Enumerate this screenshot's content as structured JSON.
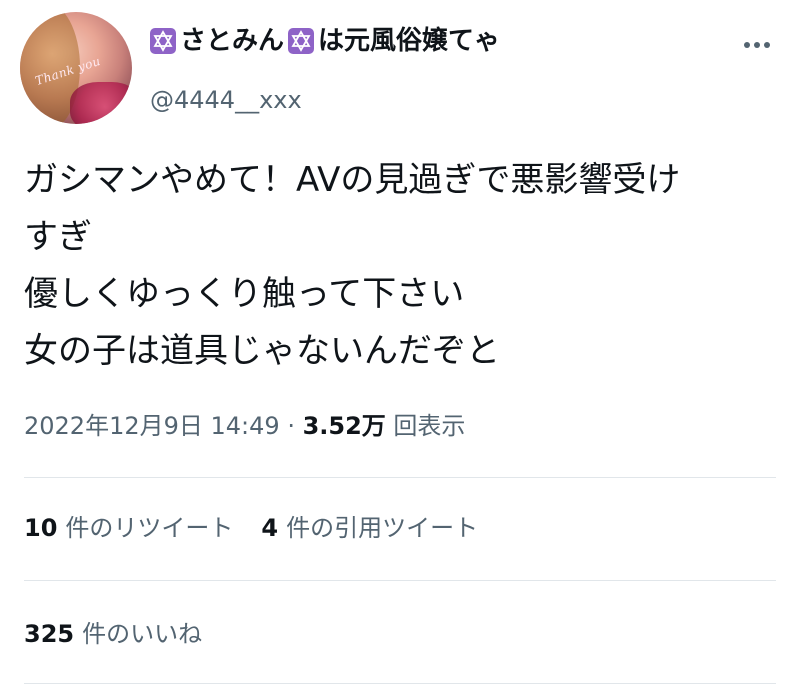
{
  "author": {
    "display_name_prefix_icon": "star-of-david-icon",
    "display_name_part1": "さとみん",
    "display_name_mid_icon": "star-of-david-icon",
    "display_name_part2": "は元風俗嬢てゃ",
    "handle": "@4444__xxx",
    "avatar_script": "Thank you"
  },
  "tweet": {
    "text": "ガシマンやめて！AVの見過ぎで悪影響受け\nすぎ\n優しくゆっくり触って下さい\n女の子は道具じゃないんだぞと",
    "timestamp": "2022年12月9日 14:49",
    "separator": " · ",
    "views_count": "3.52万",
    "views_label": " 回表示"
  },
  "engagement": {
    "retweets_count": "10",
    "retweets_label": "件のリツイート",
    "quotes_count": "4",
    "quotes_label": "件の引用ツイート",
    "likes_count": "325",
    "likes_label": "件のいいね"
  },
  "colors": {
    "text": "#0f1419",
    "muted": "#536471",
    "badge": "#8e63c7",
    "divider": "#e1e6ea"
  }
}
